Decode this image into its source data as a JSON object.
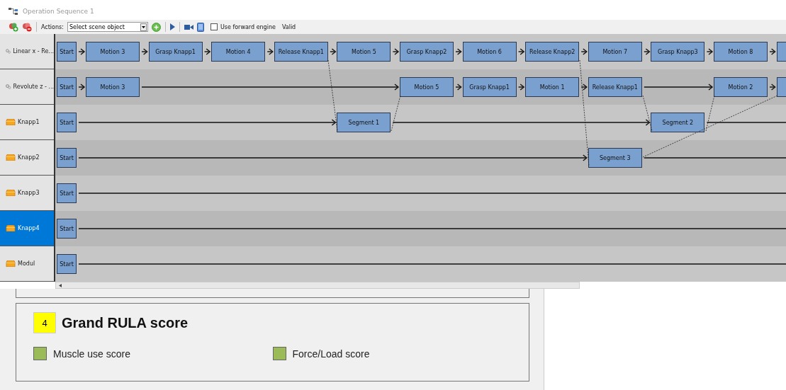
{
  "window": {
    "title": "Operation Sequence 1"
  },
  "toolbar": {
    "actions_label": "Actions:",
    "select": {
      "value": "Select scene object"
    },
    "forward_engine": {
      "label": "Use forward engine",
      "checked": false
    },
    "status": "Valid"
  },
  "lanes": [
    {
      "name": "Linear x - Re...",
      "kind": "joint",
      "selected": false,
      "cells": [
        {
          "kind": "node",
          "label": "Start"
        },
        {
          "kind": "node",
          "label": "Motion 3"
        },
        {
          "kind": "node",
          "label": "Grasp Knapp1"
        },
        {
          "kind": "node",
          "label": "Motion 4"
        },
        {
          "kind": "node",
          "label": "Release Knapp1"
        },
        {
          "kind": "node",
          "label": "Motion 5"
        },
        {
          "kind": "node",
          "label": "Grasp Knapp2"
        },
        {
          "kind": "node",
          "label": "Motion 6"
        },
        {
          "kind": "node",
          "label": "Release Knapp2"
        },
        {
          "kind": "node",
          "label": "Motion 7"
        },
        {
          "kind": "node",
          "label": "Grasp Knapp3"
        },
        {
          "kind": "node",
          "label": "Motion 8"
        },
        {
          "kind": "cut"
        }
      ]
    },
    {
      "name": "Revolute z - ...",
      "kind": "joint",
      "selected": false,
      "cells": [
        {
          "kind": "node",
          "label": "Start"
        },
        {
          "kind": "node",
          "label": "Motion 3"
        },
        {
          "kind": "line"
        },
        {
          "kind": "line"
        },
        {
          "kind": "line"
        },
        {
          "kind": "line"
        },
        {
          "kind": "node",
          "label": "Motion 5"
        },
        {
          "kind": "node",
          "label": "Grasp Knapp1"
        },
        {
          "kind": "node",
          "label": "Motion 1"
        },
        {
          "kind": "node",
          "label": "Release Knapp1"
        },
        {
          "kind": "line"
        },
        {
          "kind": "node",
          "label": "Motion 2"
        },
        {
          "kind": "cut"
        }
      ]
    },
    {
      "name": "Knapp1",
      "kind": "part",
      "selected": false,
      "cells": [
        {
          "kind": "node",
          "label": "Start"
        },
        {
          "kind": "line"
        },
        {
          "kind": "line"
        },
        {
          "kind": "line"
        },
        {
          "kind": "line"
        },
        {
          "kind": "node",
          "label": "Segment 1"
        },
        {
          "kind": "line"
        },
        {
          "kind": "line"
        },
        {
          "kind": "line"
        },
        {
          "kind": "line"
        },
        {
          "kind": "node",
          "label": "Segment 2"
        },
        {
          "kind": "line"
        },
        {
          "kind": "line"
        }
      ]
    },
    {
      "name": "Knapp2",
      "kind": "part",
      "selected": false,
      "cells": [
        {
          "kind": "node",
          "label": "Start"
        },
        {
          "kind": "line"
        },
        {
          "kind": "line"
        },
        {
          "kind": "line"
        },
        {
          "kind": "line"
        },
        {
          "kind": "line"
        },
        {
          "kind": "line"
        },
        {
          "kind": "line"
        },
        {
          "kind": "line"
        },
        {
          "kind": "node",
          "label": "Segment 3"
        },
        {
          "kind": "line"
        },
        {
          "kind": "line"
        },
        {
          "kind": "line"
        }
      ]
    },
    {
      "name": "Knapp3",
      "kind": "part",
      "selected": false,
      "cells": [
        {
          "kind": "node",
          "label": "Start"
        },
        {
          "kind": "line"
        },
        {
          "kind": "line"
        },
        {
          "kind": "line"
        },
        {
          "kind": "line"
        },
        {
          "kind": "line"
        },
        {
          "kind": "line"
        },
        {
          "kind": "line"
        },
        {
          "kind": "line"
        },
        {
          "kind": "line"
        },
        {
          "kind": "line"
        },
        {
          "kind": "line"
        },
        {
          "kind": "line"
        }
      ]
    },
    {
      "name": "Knapp4",
      "kind": "part",
      "selected": true,
      "cells": [
        {
          "kind": "node",
          "label": "Start"
        },
        {
          "kind": "line"
        },
        {
          "kind": "line"
        },
        {
          "kind": "line"
        },
        {
          "kind": "line"
        },
        {
          "kind": "line"
        },
        {
          "kind": "line"
        },
        {
          "kind": "line"
        },
        {
          "kind": "line"
        },
        {
          "kind": "line"
        },
        {
          "kind": "line"
        },
        {
          "kind": "line"
        },
        {
          "kind": "line"
        }
      ]
    },
    {
      "name": "Modul",
      "kind": "part",
      "selected": false,
      "cells": [
        {
          "kind": "node",
          "label": "Start"
        },
        {
          "kind": "line"
        },
        {
          "kind": "line"
        },
        {
          "kind": "line"
        },
        {
          "kind": "line"
        },
        {
          "kind": "line"
        },
        {
          "kind": "line"
        },
        {
          "kind": "line"
        },
        {
          "kind": "line"
        },
        {
          "kind": "line"
        },
        {
          "kind": "line"
        },
        {
          "kind": "line"
        },
        {
          "kind": "line"
        }
      ]
    }
  ],
  "rula": {
    "score": {
      "value": "4",
      "label": "Grand RULA score",
      "color": "#ffff00"
    },
    "items": [
      {
        "label": "Muscle use score",
        "color": "#9bbb59"
      },
      {
        "label": "Force/Load score",
        "color": "#9bbb59"
      }
    ]
  }
}
